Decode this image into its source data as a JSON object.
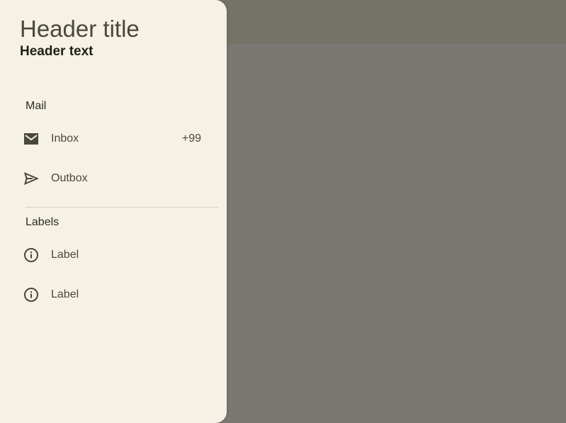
{
  "drawer": {
    "header_title": "Header title",
    "header_text": "Header text",
    "sections": [
      {
        "label": "Mail",
        "items": [
          {
            "label": "Inbox",
            "badge": "+99",
            "icon": "mail-icon"
          },
          {
            "label": "Outbox",
            "icon": "send-icon"
          }
        ]
      },
      {
        "label": "Labels",
        "items": [
          {
            "label": "Label",
            "icon": "info-icon"
          },
          {
            "label": "Label",
            "icon": "info-icon"
          }
        ]
      }
    ]
  },
  "colors": {
    "drawer_background": "#f6f1e5",
    "icon": "#4a4838",
    "scrim": "#000000"
  }
}
